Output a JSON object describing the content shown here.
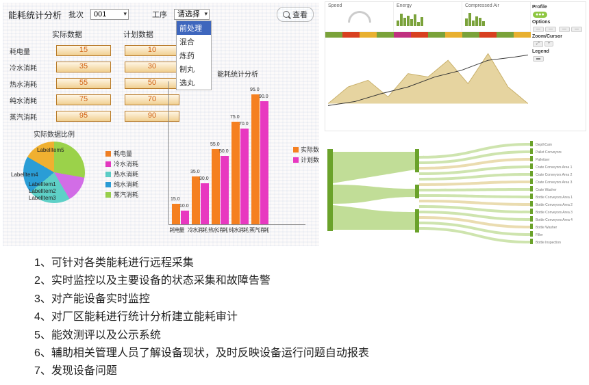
{
  "header": {
    "title": "能耗统计分析",
    "batch_label": "批次",
    "batch_value": "001",
    "process_label": "工序",
    "process_value": "请选择",
    "process_options": [
      "请选择",
      "前处理",
      "混合",
      "炼药",
      "制丸",
      "选丸"
    ],
    "search_label": "查看"
  },
  "columns": {
    "actual": "实际数据",
    "plan": "计划数据"
  },
  "rows": [
    {
      "label": "耗电量",
      "actual": "15",
      "plan": "10"
    },
    {
      "label": "冷水消耗",
      "actual": "35",
      "plan": "30"
    },
    {
      "label": "热水消耗",
      "actual": "55",
      "plan": "50"
    },
    {
      "label": "纯水消耗",
      "actual": "75",
      "plan": "70"
    },
    {
      "label": "蒸汽消耗",
      "actual": "95",
      "plan": "90"
    }
  ],
  "pie": {
    "title": "实际数据比例",
    "labels": [
      "LabelItem5",
      "LabelItem4",
      "LabelItem1",
      "LabelItem2",
      "LabelItem3"
    ],
    "legend": [
      "耗电量",
      "冷水消耗",
      "热水消耗",
      "纯水消耗",
      "蒸汽消耗"
    ],
    "colors": [
      "#9bd24a",
      "#d26de6",
      "#5ed0c7",
      "#2a9dd6",
      "#f0b030"
    ]
  },
  "chart_data": {
    "type": "bar",
    "title": "能耗统计分析",
    "categories": [
      "耗电量",
      "冷水消耗",
      "热水消耗",
      "纯水消耗",
      "蒸汽消耗"
    ],
    "series": [
      {
        "name": "实际数据",
        "values": [
          15,
          35,
          55,
          75,
          95
        ],
        "color": "#f58020"
      },
      {
        "name": "计划数据",
        "values": [
          10,
          30,
          50,
          70,
          90
        ],
        "color": "#e838c0"
      }
    ],
    "ylim": [
      0,
      100
    ],
    "legend_labels": [
      "实际数",
      "计划数"
    ]
  },
  "dashboard": {
    "gauges": [
      "Speed",
      "Energy",
      "Compressed Air"
    ],
    "panels": {
      "profile": "Profile",
      "options": "Options",
      "zoom": "Zoom/Cursor",
      "legend": "Legend"
    },
    "strip_colors": [
      "#7aa23a",
      "#d84020",
      "#e8b030",
      "#7aa23a",
      "#c03080",
      "#d84020",
      "#7aa23a",
      "#e8b030",
      "#7aa23a",
      "#d84020",
      "#7aa23a",
      "#e8b030"
    ]
  },
  "sankey": {
    "nodes_right": [
      "DepthCam",
      "Pallet Conveyors",
      "Palletiser",
      "Crate Conveyors Area 1",
      "Crate Conveyors Area 2",
      "Crate Conveyors Area 3",
      "Crate Washer",
      "Bottle Conveyors Area 1",
      "Bottle Conveyors Area 2",
      "Bottle Conveyors Area 3",
      "Bottle Conveyors Area 4",
      "Bottle Washer",
      "Filler",
      "Bottle Inspection"
    ]
  },
  "bullets": [
    "1、可针对各类能耗进行远程采集",
    "2、实时监控以及主要设备的状态采集和故障告警",
    "3、对产能设备实时监控",
    "4、对厂区能耗进行统计分析建立能耗审计",
    "5、能效测评以及公示系统",
    "6、辅助相关管理人员了解设备现状，及时反映设备运行问题自动报表",
    "7、发现设备问题"
  ]
}
